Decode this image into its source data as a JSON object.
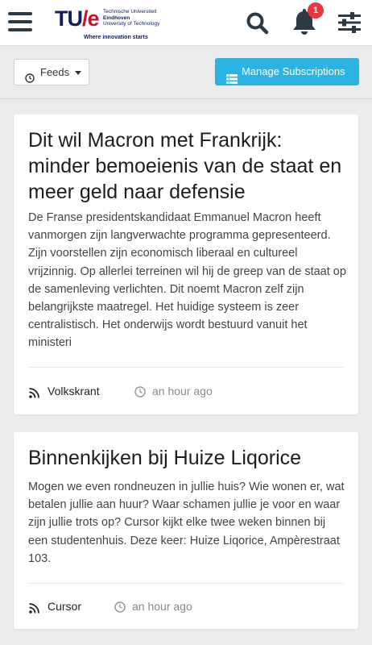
{
  "header": {
    "logo": {
      "mark": "TU/e",
      "university_lines": [
        "Technische Universiteit",
        "Eindhoven",
        "University of Technology"
      ],
      "tagline": "Where innovation starts"
    },
    "notifications_count": "1",
    "icons": {
      "menu": "hamburger-icon",
      "search": "search-icon",
      "bell": "bell-icon",
      "settings": "sliders-icon"
    }
  },
  "toolbar": {
    "feeds_label": "Feeds",
    "manage_label": "Manage Subscriptions",
    "accent_color": "#2bb3e3"
  },
  "articles": [
    {
      "title": "Dit wil Macron met Frankrijk: minder bemoeienis van de staat en meer geld naar defensie",
      "body": "De Franse presidentskandidaat Emmanuel Macron heeft vanmorgen zijn langverwachte programma gepresenteerd. Zijn voorstellen zijn economisch liberaal en cultureel vrijzinnig. Op allerlei terreinen wil hij de greep van de staat op de samenleving verlichten. Dit noemt Macron zelf zijn belangrijkste maatregel. Het huidige systeem is zeer centralistisch. Het onderwijs wordt bestuurd vanuit het ministeri",
      "source": "Volkskrant",
      "time": "an hour ago"
    },
    {
      "title": "Binnenkijken bij Huize Liqorice",
      "body": "Mogen we even rondneuzen in jullie huis? Wie wonen er, wat betalen jullie aan huur? Waar schamen jullie je voor en waar zijn jullie trots op? Cursor kijkt elke twee weken binnen bij een studentenhuis. Deze keer: Huize Liqorice, Ampèrestraat 103.",
      "source": "Cursor",
      "time": "an hour ago"
    }
  ]
}
